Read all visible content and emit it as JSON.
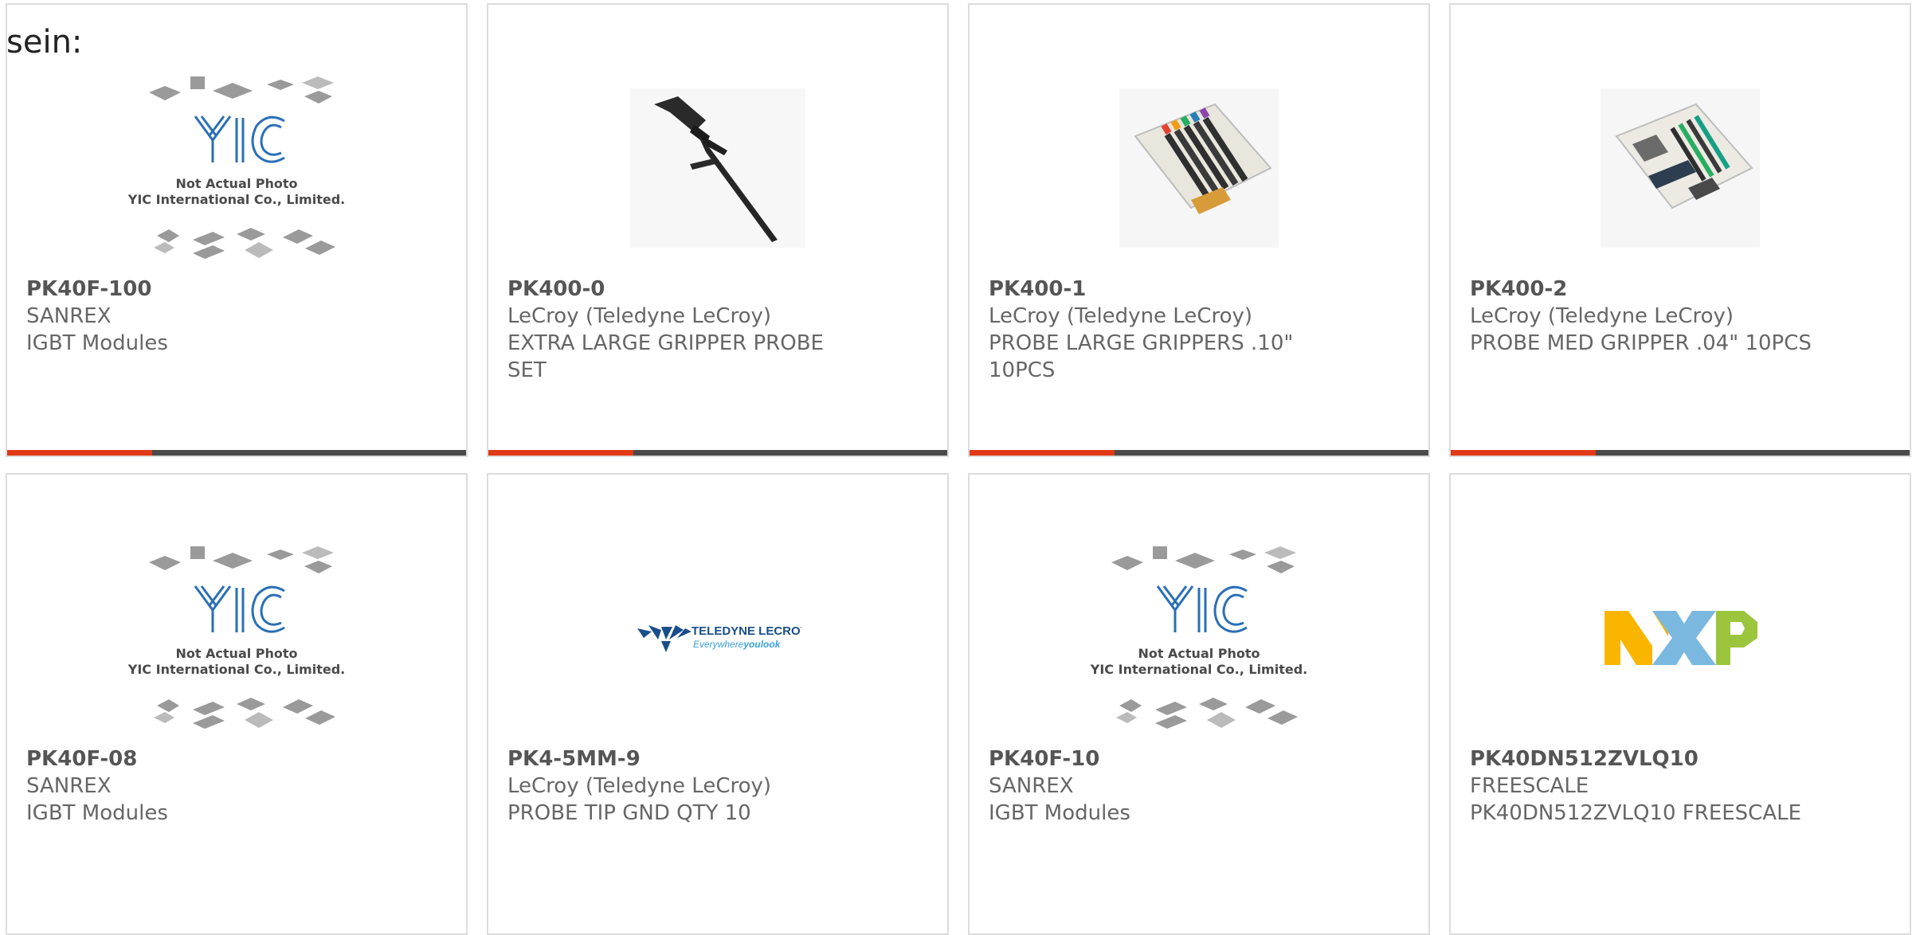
{
  "lead_text": "sein:",
  "placeholder": {
    "line1": "Not Actual Photo",
    "line2": "YIC International Co., Limited.",
    "logo_text": "YIC"
  },
  "brand_logos": {
    "teledyne": {
      "name": "TELEDYNE LECROY",
      "tagline_a": "Everywhere",
      "tagline_b": "youlook"
    },
    "nxp": {
      "name": "NXP"
    }
  },
  "colors": {
    "accent": "#e03a16",
    "bar": "#4a4a4a",
    "border": "#dcdcdc"
  },
  "products": [
    {
      "part": "PK40F-100",
      "manufacturer": "SANREX",
      "description": "IGBT Modules",
      "image": "yic-placeholder",
      "has_bar": true
    },
    {
      "part": "PK400-0",
      "manufacturer": "LeCroy (Teledyne LeCroy)",
      "description": "EXTRA LARGE GRIPPER PROBE SET",
      "image": "black-probe-photo",
      "has_bar": true
    },
    {
      "part": "PK400-1",
      "manufacturer": "LeCroy (Teledyne LeCroy)",
      "description": "PROBE LARGE GRIPPERS .10\" 10PCS",
      "image": "probe-kit-photo",
      "has_bar": true
    },
    {
      "part": "PK400-2",
      "manufacturer": "LeCroy (Teledyne LeCroy)",
      "description": "PROBE MED GRIPPER .04\" 10PCS",
      "image": "probe-kit-photo",
      "has_bar": true
    },
    {
      "part": "PK40F-08",
      "manufacturer": "SANREX",
      "description": "IGBT Modules",
      "image": "yic-placeholder",
      "has_bar": false
    },
    {
      "part": "PK4-5MM-9",
      "manufacturer": "LeCroy (Teledyne LeCroy)",
      "description": "PROBE TIP GND QTY 10",
      "image": "teledyne-logo",
      "has_bar": false
    },
    {
      "part": "PK40F-10",
      "manufacturer": "SANREX",
      "description": "IGBT Modules",
      "image": "yic-placeholder",
      "has_bar": false
    },
    {
      "part": "PK40DN512ZVLQ10",
      "manufacturer": "FREESCALE",
      "description": "PK40DN512ZVLQ10 FREESCALE",
      "image": "nxp-logo",
      "has_bar": false
    }
  ]
}
